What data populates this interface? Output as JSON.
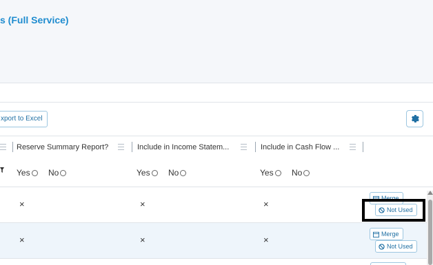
{
  "page": {
    "title": "s (Full Service)"
  },
  "toolbar": {
    "export_label": "xport to Excel",
    "gear_icon": "gear-icon"
  },
  "columns": [
    {
      "label": "Reserve Summary Report?"
    },
    {
      "label": "Include in Income Statem..."
    },
    {
      "label": "Include in Cash Flow ..."
    }
  ],
  "filters": {
    "yes": "Yes",
    "no": "No"
  },
  "rows": [
    {
      "values": [
        "×",
        "×",
        "×"
      ],
      "merge": "Merge",
      "not_used": "Not Used"
    },
    {
      "values": [
        "×",
        "×",
        "×"
      ],
      "merge": "Merge",
      "not_used": "Not Used"
    }
  ],
  "colors": {
    "accent": "#1f8ccf",
    "row_alt": "#eef5fb",
    "highlight": "#000000"
  }
}
